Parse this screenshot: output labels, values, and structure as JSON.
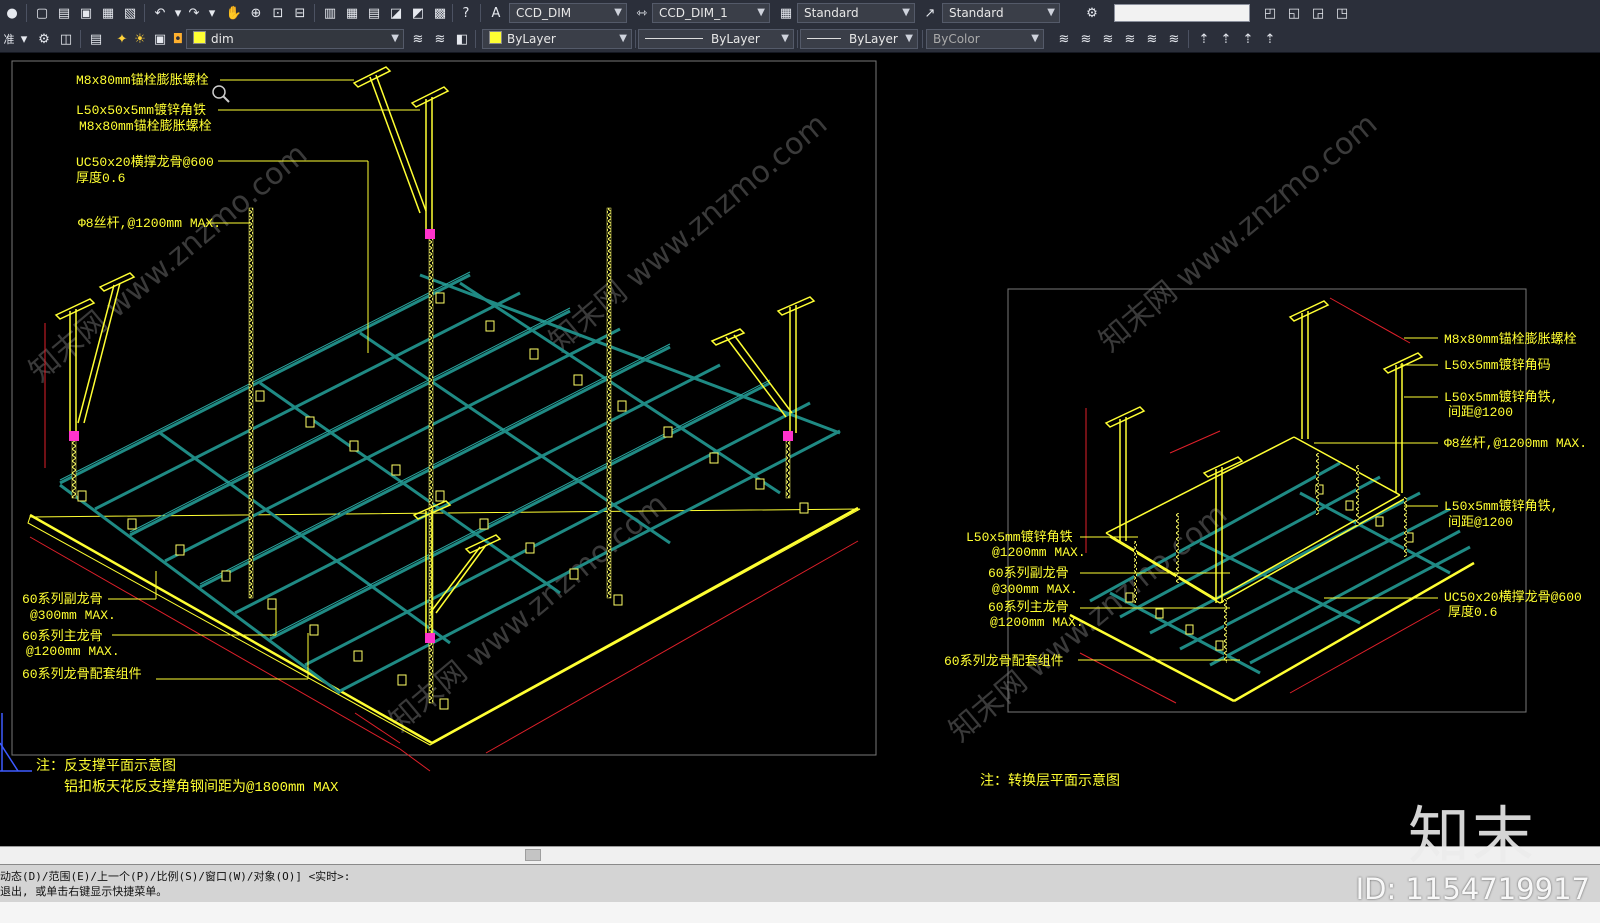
{
  "toolbar1": {
    "dimstyle_combo": "CCD_DIM",
    "dimstyle2_combo": "CCD_DIM_1",
    "tablestyle_combo": "Standard",
    "mleaderstyle_combo": "Standard",
    "search_value": ""
  },
  "toolbar2": {
    "workspace_label": "准",
    "layer_combo": "dim",
    "color_combo": "ByLayer",
    "linetype_combo": "ByLayer",
    "lineweight_combo": "ByLayer",
    "plotstyle_combo": "ByColor"
  },
  "drawing": {
    "left": {
      "labels": {
        "l1": "M8x80mm锚栓膨胀螺栓",
        "l2": "L50x50x5mm镀锌角铁",
        "l3": "M8x80mm锚栓膨胀螺栓",
        "l4a": "UC50x20横撑龙骨@600",
        "l4b": "厚度0.6",
        "l5": "Φ8丝杆,@1200mm MAX.",
        "l6a": "60系列副龙骨",
        "l6b": "@300mm MAX.",
        "l7a": "60系列主龙骨",
        "l7b": "@1200mm MAX.",
        "l8": "60系列龙骨配套组件"
      },
      "note1": "注：反支撑平面示意图",
      "note2": "铝扣板天花反支撑角钢间距为@1800mm MAX"
    },
    "right": {
      "labels": {
        "r1": "M8x80mm锚栓膨胀螺栓",
        "r2": "L50x5mm镀锌角码",
        "r3a": "L50x5mm镀锌角铁,",
        "r3b": "间距@1200",
        "r4": "Φ8丝杆,@1200mm MAX.",
        "r5a": "L50x5mm镀锌角铁,",
        "r5b": "间距@1200",
        "r6a": "L50x5mm镀锌角铁",
        "r6b": "@1200mm MAX.",
        "r7a": "60系列副龙骨",
        "r7b": "@300mm MAX.",
        "r8a": "60系列主龙骨",
        "r8b": "@1200mm MAX.",
        "r9a": "UC50x20横撑龙骨@600",
        "r9b": "厚度0.6",
        "r10": "60系列龙骨配套组件"
      },
      "note": "注：转换层平面示意图"
    },
    "watermark_text": "知末网 www.znzmo.com"
  },
  "command": {
    "line1": "动态(D)/范围(E)/上一个(P)/比例(S)/窗口(W)/对象(O)] <实时>:",
    "line2": "退出, 或单击右键显示快捷菜单。"
  },
  "watermark": {
    "brand": "知末",
    "id": "ID: 1154719917"
  },
  "colors": {
    "model_bg": "#000000",
    "leader_yellow": "#ffff33",
    "grid_teal": "#1f8a84",
    "dim_red": "#e0202a",
    "rod_pink": "#ff33cc"
  }
}
